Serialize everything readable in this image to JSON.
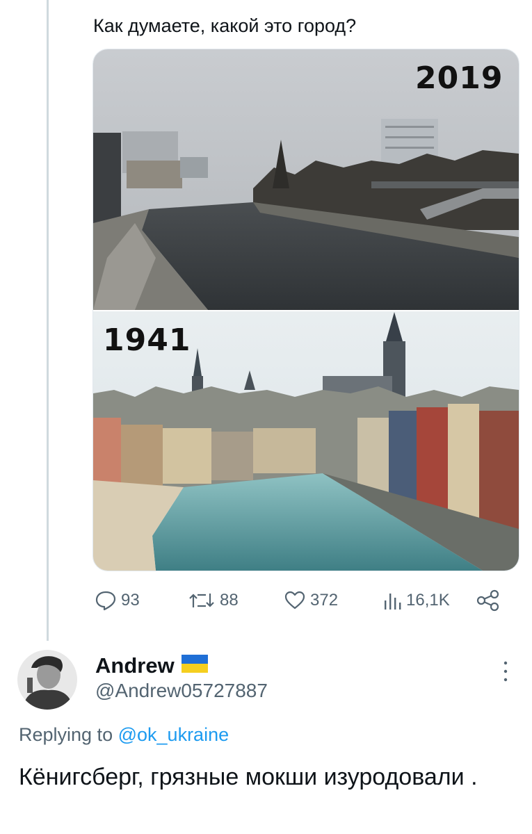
{
  "tweet": {
    "text": "Как думаете, какой это город?",
    "media": {
      "top_year": "2019",
      "bottom_year": "1941"
    },
    "actions": {
      "replies": "93",
      "retweets": "88",
      "likes": "372",
      "views": "16,1K"
    }
  },
  "reply": {
    "author_name": "Andrew",
    "author_handle": "@Andrew05727887",
    "replying_prefix": "Replying to",
    "replying_to": "@ok_ukraine",
    "text": "Кёнигсберг, грязные мокши изуродовали ."
  },
  "colors": {
    "muted": "#536471",
    "link": "#1d9bf0",
    "thread_line": "#cfd9de"
  }
}
